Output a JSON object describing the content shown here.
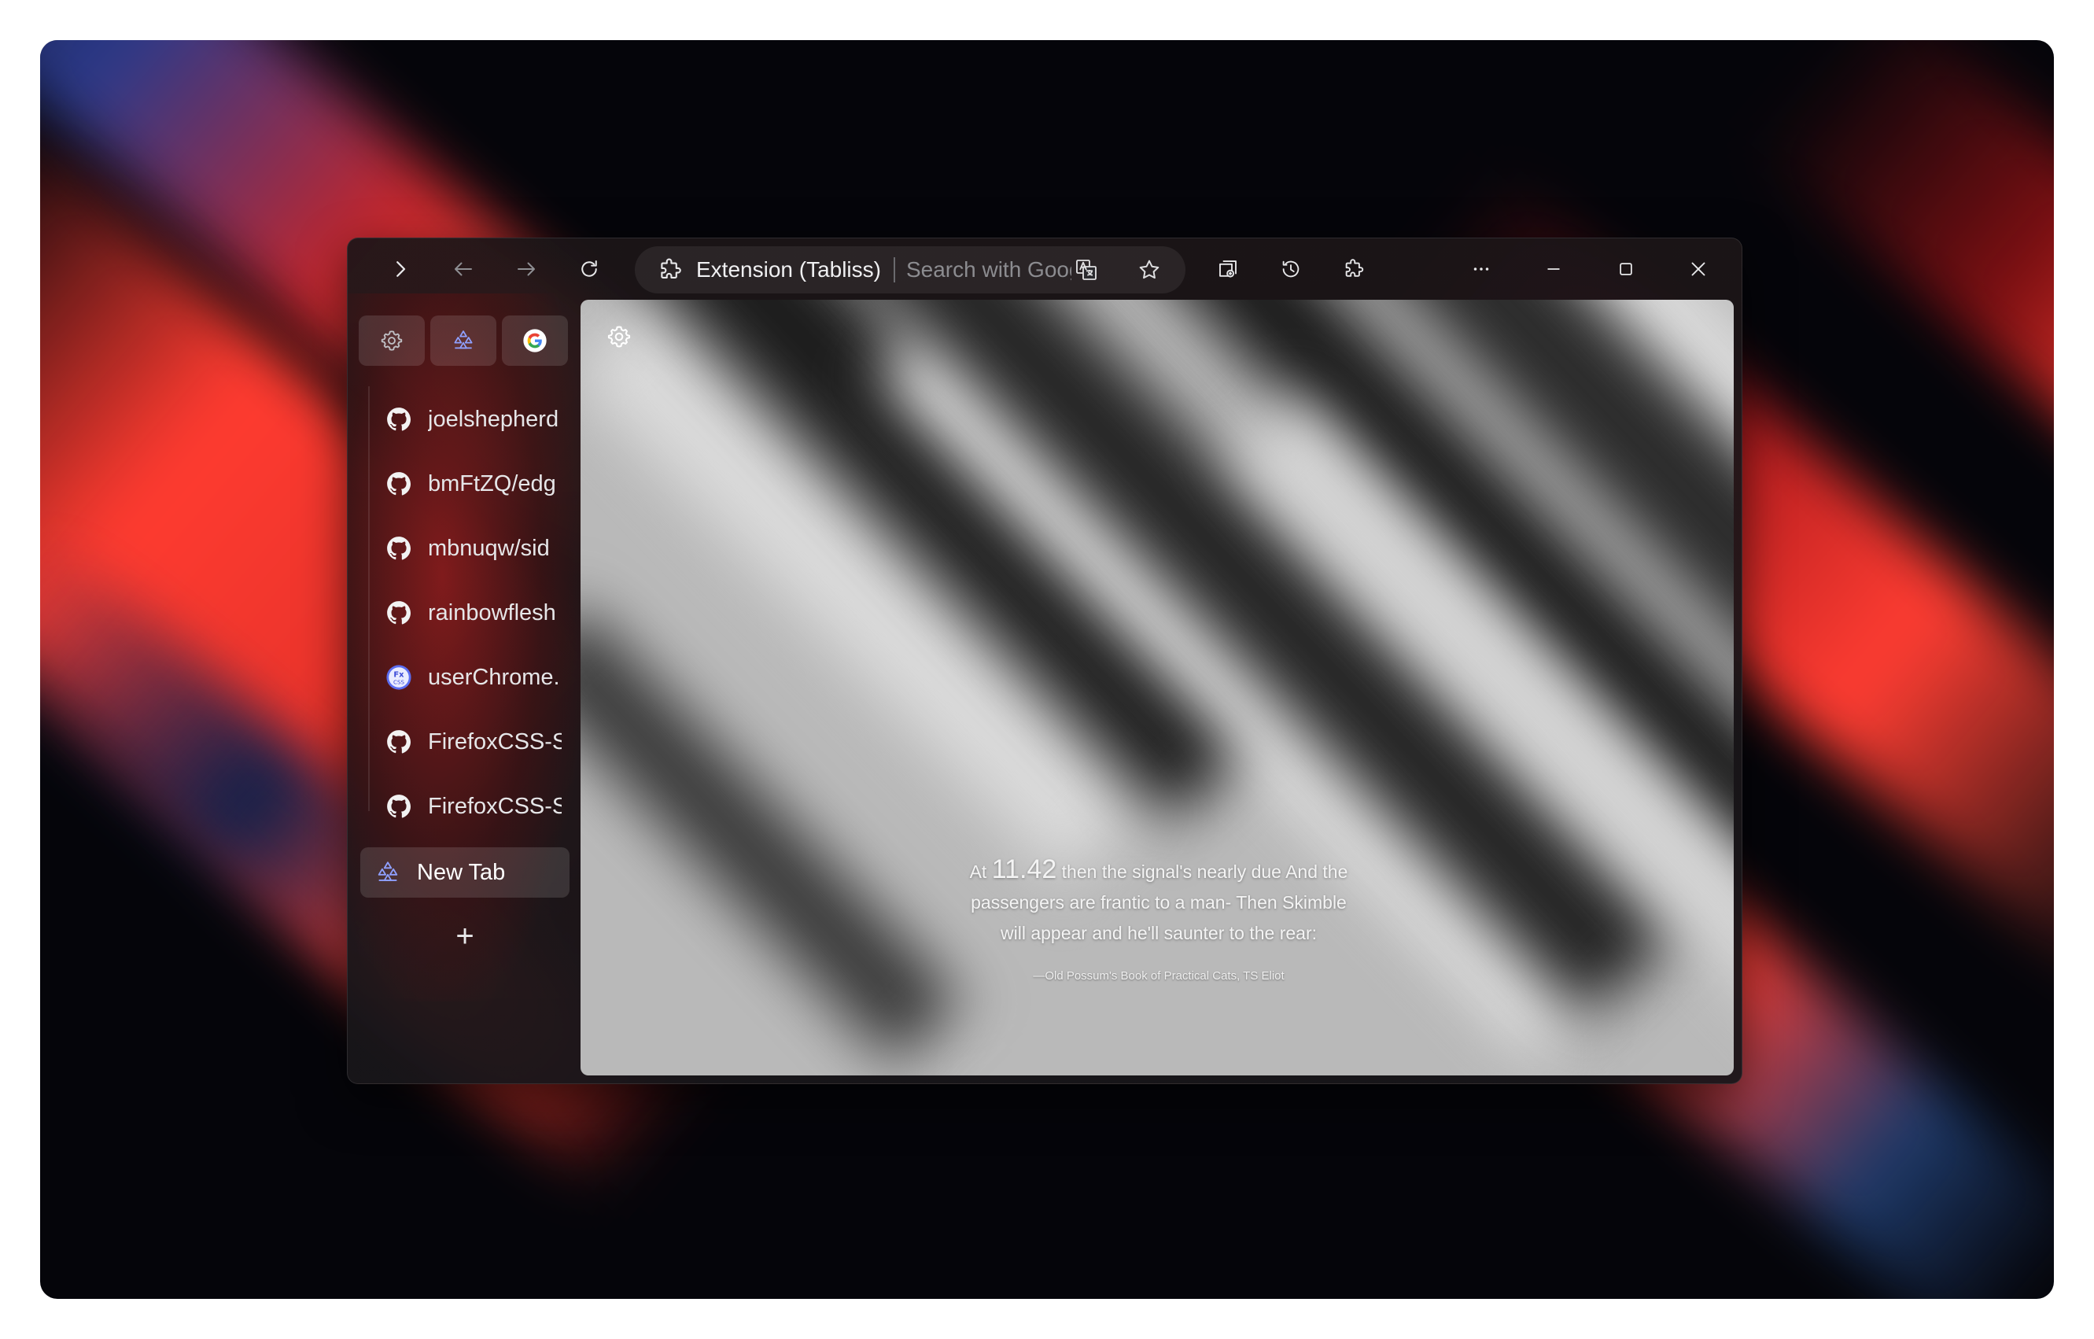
{
  "desktop": {
    "colors": {
      "accent_red": "#ff3b30",
      "deep_blue": "#2b3a8a",
      "background": "#05050a"
    }
  },
  "toolbar": {
    "icons": {
      "sidebar_toggle": "chevron-right-icon",
      "back": "arrow-left-icon",
      "forward": "arrow-right-icon",
      "reload": "reload-icon",
      "collections": "collections-icon",
      "history": "history-icon",
      "extensions": "puzzle-icon",
      "more": "more-icon",
      "minimize": "minimize-icon",
      "maximize": "maximize-icon",
      "close": "close-icon"
    },
    "urlbar": {
      "site_label": "Extension (Tabliss)",
      "placeholder": "Search with Goog",
      "translate_icon": "translate-icon",
      "favorite_icon": "star-icon"
    }
  },
  "sidebar": {
    "pinned": [
      {
        "icon": "settings-icon"
      },
      {
        "icon": "tabliss-icon"
      },
      {
        "icon": "google-icon"
      }
    ],
    "tabs": [
      {
        "label": "joelshepherd",
        "icon": "github-icon"
      },
      {
        "label": "bmFtZQ/edg",
        "icon": "github-icon"
      },
      {
        "label": "mbnuqw/sid",
        "icon": "github-icon"
      },
      {
        "label": "rainbowflesh",
        "icon": "github-icon"
      },
      {
        "label": "userChrome.",
        "icon": "firefoxcss-icon"
      },
      {
        "label": "FirefoxCSS-S",
        "icon": "github-icon"
      },
      {
        "label": "FirefoxCSS-S",
        "icon": "github-icon"
      }
    ],
    "active_tab": {
      "label": "New Tab",
      "icon": "tabliss-icon"
    },
    "new_tab_button": "+"
  },
  "content": {
    "quote": {
      "prefix": "At ",
      "time": "11.42",
      "line1_rest": " then the signal's nearly due And the",
      "line2": "passengers are frantic to a man- Then Skimble",
      "line3": "will appear and he'll saunter to the rear:",
      "source": "—Old Possum's Book of Practical Cats, TS Eliot"
    }
  }
}
